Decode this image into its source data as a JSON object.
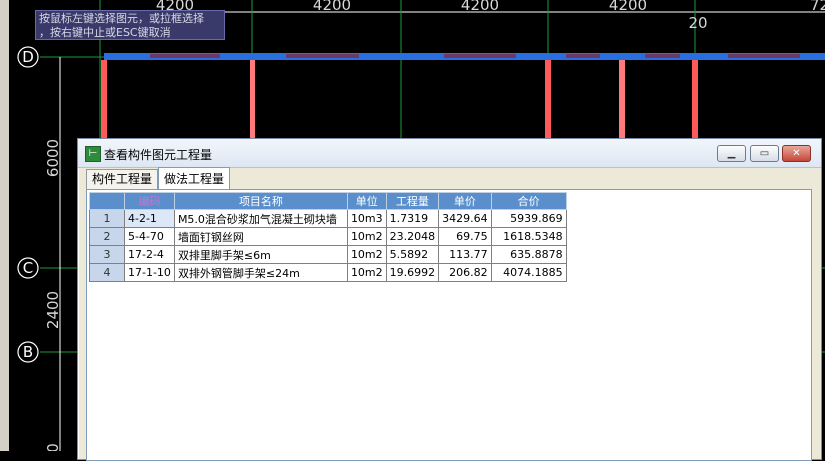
{
  "cad": {
    "dimensions": [
      "4200",
      "4200",
      "4200",
      "4200",
      "72"
    ],
    "left_dims": [
      "6000",
      "2400",
      "0"
    ],
    "axis_labels": [
      "D",
      "C",
      "B"
    ],
    "marker": "20",
    "hint_lines": [
      "按鼠标左键选择图元，或拉框选择",
      "，按右键中止或ESC键取消"
    ]
  },
  "window": {
    "title": "查看构件图元工程量",
    "buttons": [
      "minimize",
      "restore",
      "close"
    ]
  },
  "tabs": [
    {
      "label": "构件工程量",
      "active": false
    },
    {
      "label": "做法工程量",
      "active": true
    }
  ],
  "table": {
    "headers": [
      "编码",
      "项目名称",
      "单位",
      "工程量",
      "单价",
      "合价"
    ],
    "rows": [
      {
        "num": "1",
        "code": "4-2-1",
        "name": "M5.0混合砂浆加气混凝土砌块墙",
        "unit": "10m3",
        "qty": "1.7319",
        "price": "3429.64",
        "total": "5939.869"
      },
      {
        "num": "2",
        "code": "5-4-70",
        "name": "墙面钉钢丝网",
        "unit": "10m2",
        "qty": "23.2048",
        "price": "69.75",
        "total": "1618.5348"
      },
      {
        "num": "3",
        "code": "17-2-4",
        "name": "双排里脚手架≤6m",
        "unit": "10m2",
        "qty": "5.5892",
        "price": "113.77",
        "total": "635.8878"
      },
      {
        "num": "4",
        "code": "17-1-10",
        "name": "双排外钢管脚手架≤24m",
        "unit": "10m2",
        "qty": "19.6992",
        "price": "206.82",
        "total": "4074.1885"
      }
    ]
  }
}
